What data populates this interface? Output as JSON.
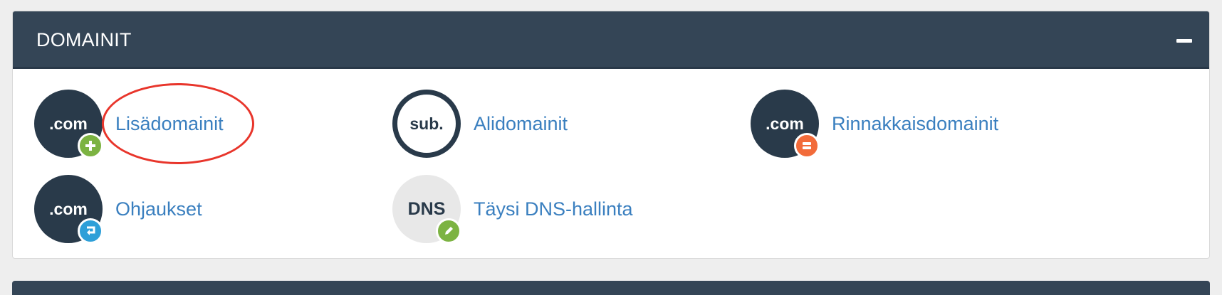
{
  "panel": {
    "title": "DOMAINIT",
    "collapse_icon": "minus-icon"
  },
  "items": [
    {
      "label": "Lisädomainit",
      "icon_text": ".com",
      "badge": "plus-icon",
      "badge_color": "#7cb342"
    },
    {
      "label": "Alidomainit",
      "icon_text": "sub.",
      "badge": null
    },
    {
      "label": "Rinnakkaisdomainit",
      "icon_text": ".com",
      "badge": "equals-icon",
      "badge_color": "#f26b3a"
    },
    {
      "label": "Ohjaukset",
      "icon_text": ".com",
      "badge": "redirect-icon",
      "badge_color": "#2e9fd8"
    },
    {
      "label": "Täysi DNS-hallinta",
      "icon_text": "DNS",
      "badge": "pencil-icon",
      "badge_color": "#7cb342"
    }
  ],
  "colors": {
    "header_bg": "#344556",
    "link": "#3a7fbf",
    "icon_dark": "#293a4a",
    "highlight": "#e8352b"
  }
}
